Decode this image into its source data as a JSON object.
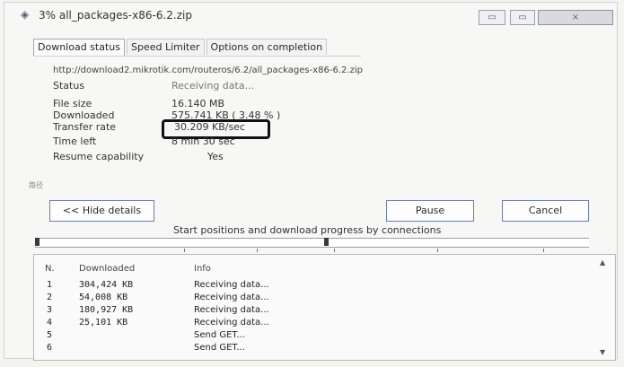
{
  "window": {
    "title": "3% all_packages-x86-6.2.zip",
    "buttons": {
      "minimize": "▭",
      "maximize": "▭",
      "close": "×"
    }
  },
  "tabs": [
    "Download status",
    "Speed Limiter",
    "Options on completion"
  ],
  "details": {
    "url": "http://download2.mikrotik.com/routeros/6.2/all_packages-x86-6.2.zip",
    "status_label": "Status",
    "status_value": "Receiving data...",
    "file_size_label": "File size",
    "file_size_value": "16.140  MB",
    "downloaded_label": "Downloaded",
    "downloaded_value": "575.741  KB  ( 3.48 % )",
    "transfer_rate_label": "Transfer rate",
    "transfer_rate_value": "30.209  KB/sec",
    "time_left_label": "Time left",
    "time_left_value": "8 min 30 sec",
    "resume_label": "Resume capability",
    "resume_value": "Yes"
  },
  "small_tag": "路径",
  "controls": {
    "hide_details": "<< Hide details",
    "pause": "Pause",
    "cancel": "Cancel"
  },
  "progress": {
    "title": "Start positions and download progress by connections"
  },
  "connections": {
    "headers": {
      "n": "N.",
      "downloaded": "Downloaded",
      "info": "Info"
    },
    "rows": [
      {
        "n": "1",
        "downloaded": "304,424 KB",
        "info": "Receiving data..."
      },
      {
        "n": "2",
        "downloaded": "54,008 KB",
        "info": "Receiving data..."
      },
      {
        "n": "3",
        "downloaded": "180,927 KB",
        "info": "Receiving data..."
      },
      {
        "n": "4",
        "downloaded": "25,101 KB",
        "info": "Receiving data..."
      },
      {
        "n": "5",
        "downloaded": "",
        "info": "Send GET..."
      },
      {
        "n": "6",
        "downloaded": "",
        "info": "Send GET..."
      }
    ]
  },
  "icons": {
    "app": "download-icon",
    "scroll_up": "scroll-up-icon",
    "scroll_down": "scroll-down-icon"
  }
}
